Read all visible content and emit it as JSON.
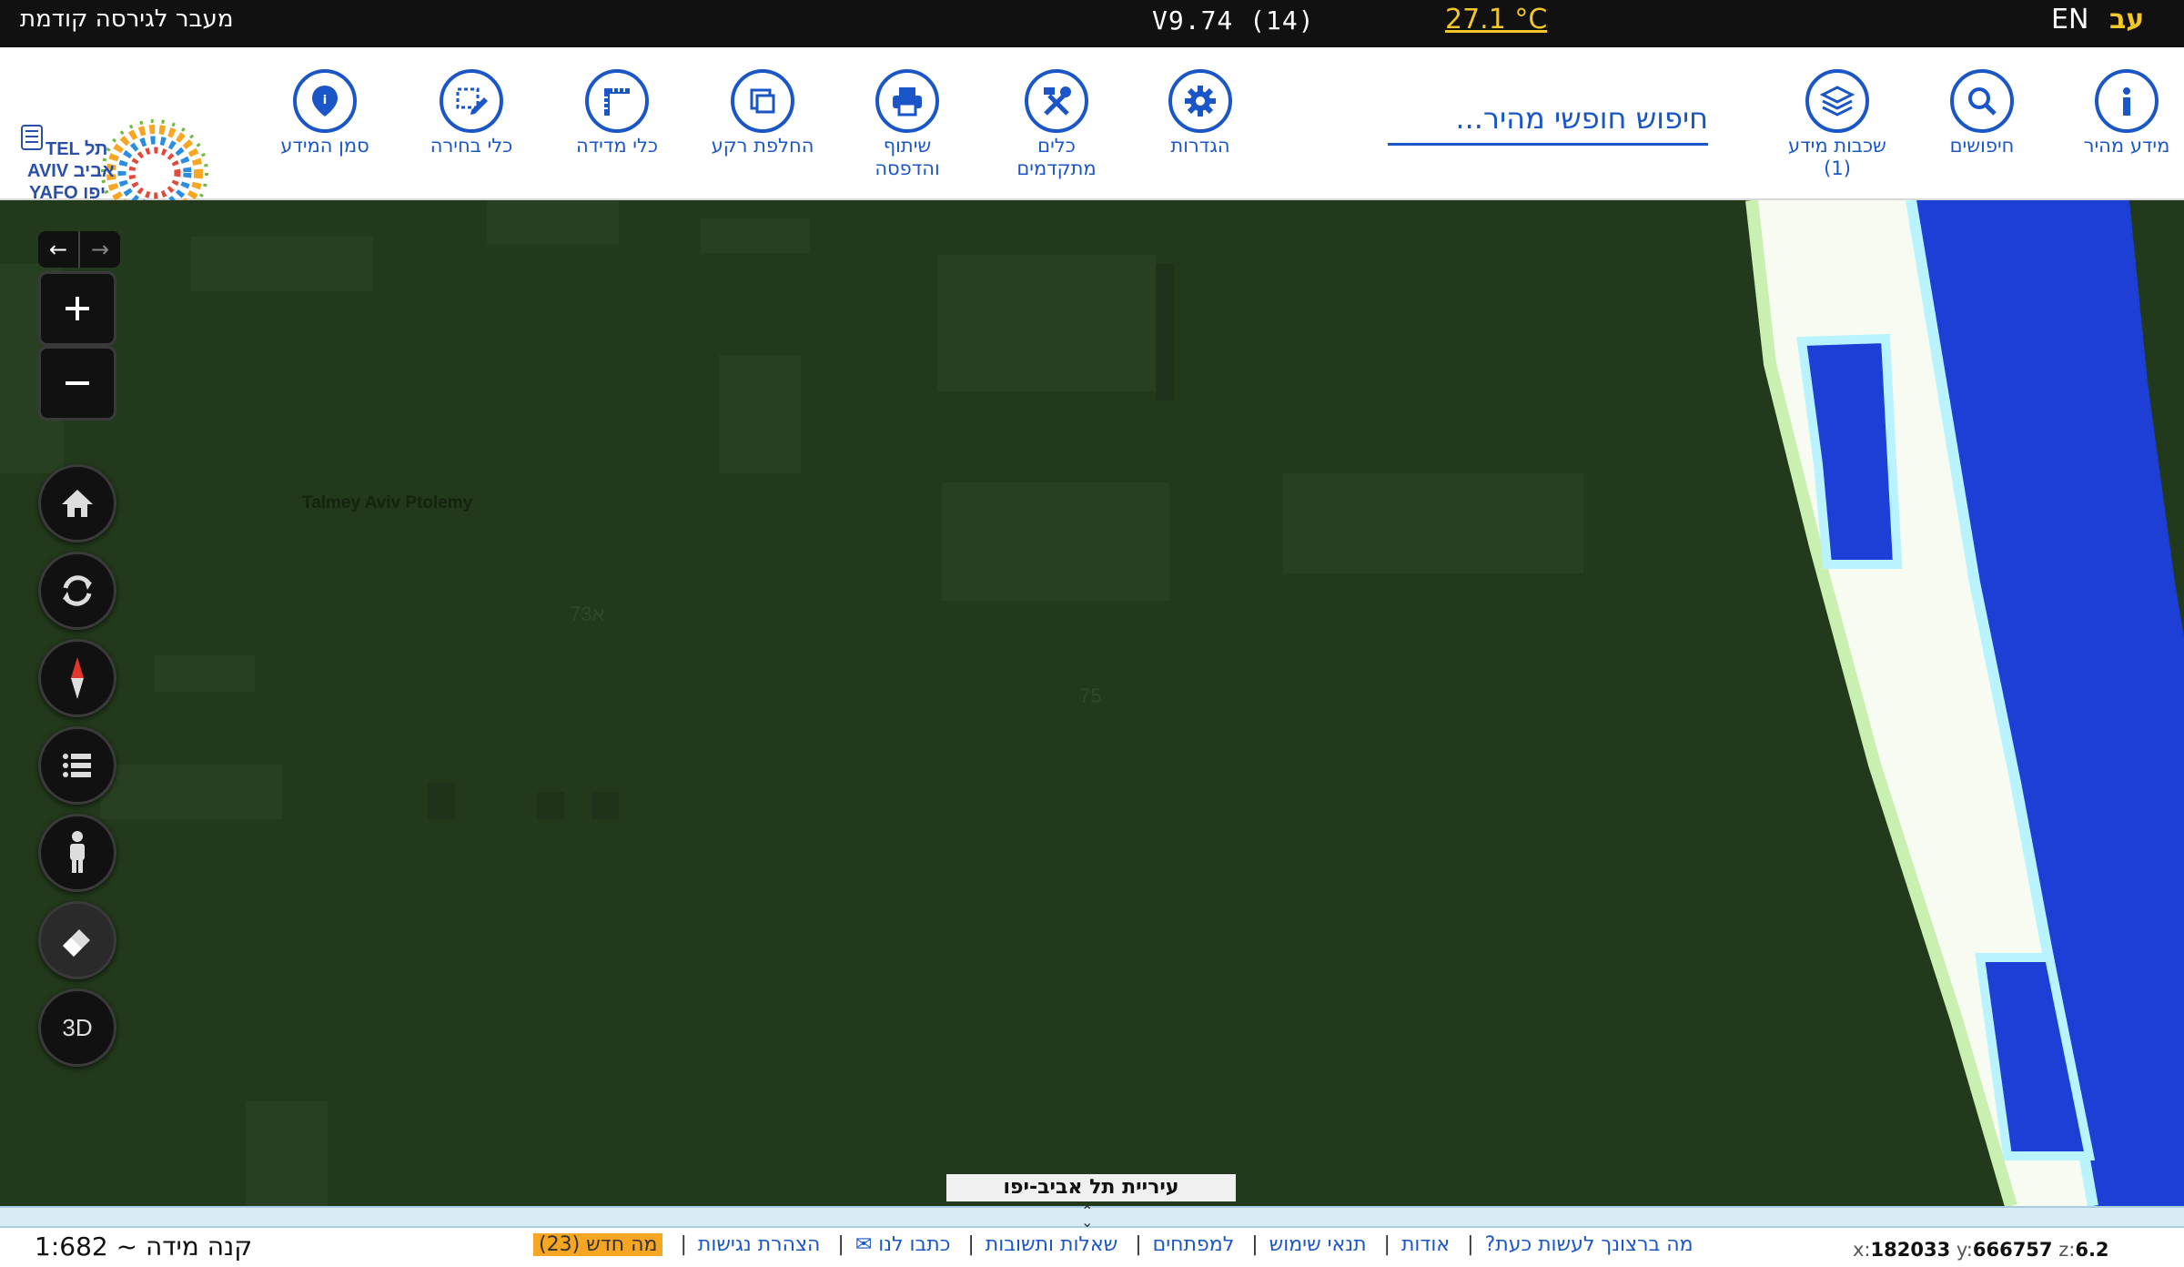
{
  "topbar": {
    "prev_version": "מעבר לגירסה קודמת",
    "version": "V9.74 (14)",
    "temperature": "27.1 °C",
    "lang_en": "EN",
    "lang_he": "עב"
  },
  "toolbar": {
    "tools": [
      {
        "label": "סמן המידע",
        "icon": "info-marker-icon"
      },
      {
        "label": "כלי בחירה",
        "icon": "select-tool-icon"
      },
      {
        "label": "כלי מדידה",
        "icon": "ruler-icon"
      },
      {
        "label": "החלפת רקע",
        "icon": "layers-square-icon"
      },
      {
        "label": "שיתוף\nוהדפסה",
        "icon": "printer-icon"
      },
      {
        "label": "כלים\nמתקדמים",
        "icon": "tools-icon"
      },
      {
        "label": "הגדרות",
        "icon": "gear-icon"
      },
      {
        "label": "שכבות מידע\n(1)",
        "icon": "layers-icon"
      },
      {
        "label": "חיפושים",
        "icon": "search-icon"
      },
      {
        "label": "מידע מהיר",
        "icon": "info-icon"
      }
    ],
    "search_placeholder": "חיפוש חופשי מהיר..."
  },
  "logo": {
    "line1": "TEL תל",
    "line2": "AVIV אביב",
    "line3": "YAFO יפו"
  },
  "map": {
    "labels": [
      "Talmey Aviv Ptolemy",
      "א73",
      "75"
    ],
    "city_banner": "עיריית תל אביב-יפו",
    "controls": {
      "threed_label": "3D"
    }
  },
  "bottom": {
    "scale": "קנה מידה ~ 1:682",
    "links": [
      "מה ברצונך לעשות כעת?",
      "אודות",
      "תנאי שימוש",
      "למפתחים",
      "שאלות ותשובות",
      "כתבו לנו ✉",
      "הצהרת נגישות"
    ],
    "whats_new": "מה חדש (23)",
    "coords": {
      "x": "182033",
      "y": "666757",
      "z": "6.2"
    }
  },
  "colors": {
    "accent": "#1a56c8",
    "temp": "#f2c72a",
    "water": "#1d3fd6",
    "map_bg": "#22391c"
  }
}
